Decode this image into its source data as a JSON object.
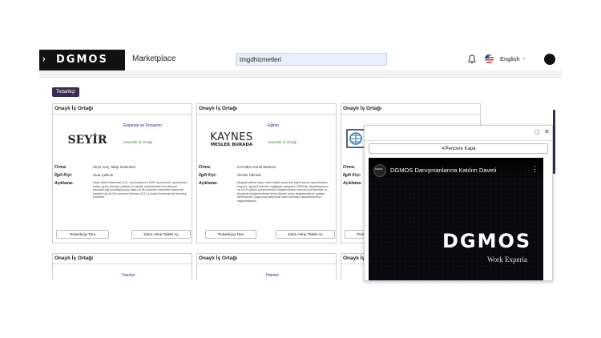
{
  "header": {
    "brand": "DGMOS",
    "menu_chevron": "›",
    "page_title": "Marketplace",
    "search_value": "tmgdhizmetleri",
    "language": "English",
    "icons": [
      "bell-icon",
      "us-flag-icon",
      "chevron-down-icon",
      "avatar-icon"
    ]
  },
  "filter_badge": "Tedarikçi",
  "card_title": "Onaylı İş Ortağı",
  "cards": [
    {
      "category": "Ekipman ve Donanım",
      "trust": "Güvenilir İş Ortağı",
      "logo": "SEYİR",
      "firma_label": "Firma:",
      "firma": "Seyir Araç Takip Sistemleri",
      "kisi_label": "İlgili Kişi:",
      "kisi": "Suat Çelikok",
      "aciklama_label": "Açıklama:",
      "aciklama": "Seyir Mobil Sistemler A.Ş., kuruluşlarının 1997 senesinden günümüze kadar gelen süreçte nakliye ve lojistik sektöründeki tecrübesini kazandırdığı avantajla araç takip ve filo yönetim sistemleri alanında kendine ait Ar-Ge merkezi bulunan 2012 yılında kurulmuş bir teknoloji şirketidir.",
      "btn_tanit": "Tedarikçiyi Tanı",
      "btn_satin": "Satın Alma Talebi Aç"
    },
    {
      "category": "Eğitim",
      "trust": "Güvenilir İş Ortağı",
      "logo": "KAYNES",
      "logo_sub": "MESLEK BURADA",
      "firma_label": "Firma:",
      "firma": "KAYNES Genel Merkezi",
      "kisi_label": "İlgili Kişi:",
      "kisi": "Serdar Ülkmek",
      "aciklama_label": "Açıklama:",
      "aciklama": "Belgelendirme talep eden kişiler arasında hiçbir ayırım gözetmeyen Kaynes, gerekli kriterleri sağlayan adaylara TÜRKAK akreditasyonu ve MYK yetkisi çerçevesinde belgelendirme sürecini yürütmekte ve önceside belgelendirme temel ilkeleri eden belgelendirme şartları belirleyerek, başvurma talepinde olan herkesin ulaşılabilmesini sağlamaktadır.",
      "btn_tanit": "Tedarikçiyi Tanı",
      "btn_satin": "Satın Alma Talebi Aç"
    },
    {
      "category": "",
      "trust": "",
      "firma_label": "Firma:",
      "kisi_label": "İlgili Kişi:",
      "aciklama_label": "Açıklama:",
      "btn_tanit": "Teda"
    }
  ],
  "cards_row2": [
    {
      "category": "Yazılım"
    },
    {
      "category": "Hizmet"
    },
    {
      "category": ""
    }
  ],
  "popup": {
    "close_label": "✕Pencere Kapa",
    "video_title": "DGMOS Danışmanlarına Katılım Daveti",
    "channel": "DGMOS",
    "video_logo": "DGMOS",
    "video_subtitle": "Work Experia"
  }
}
